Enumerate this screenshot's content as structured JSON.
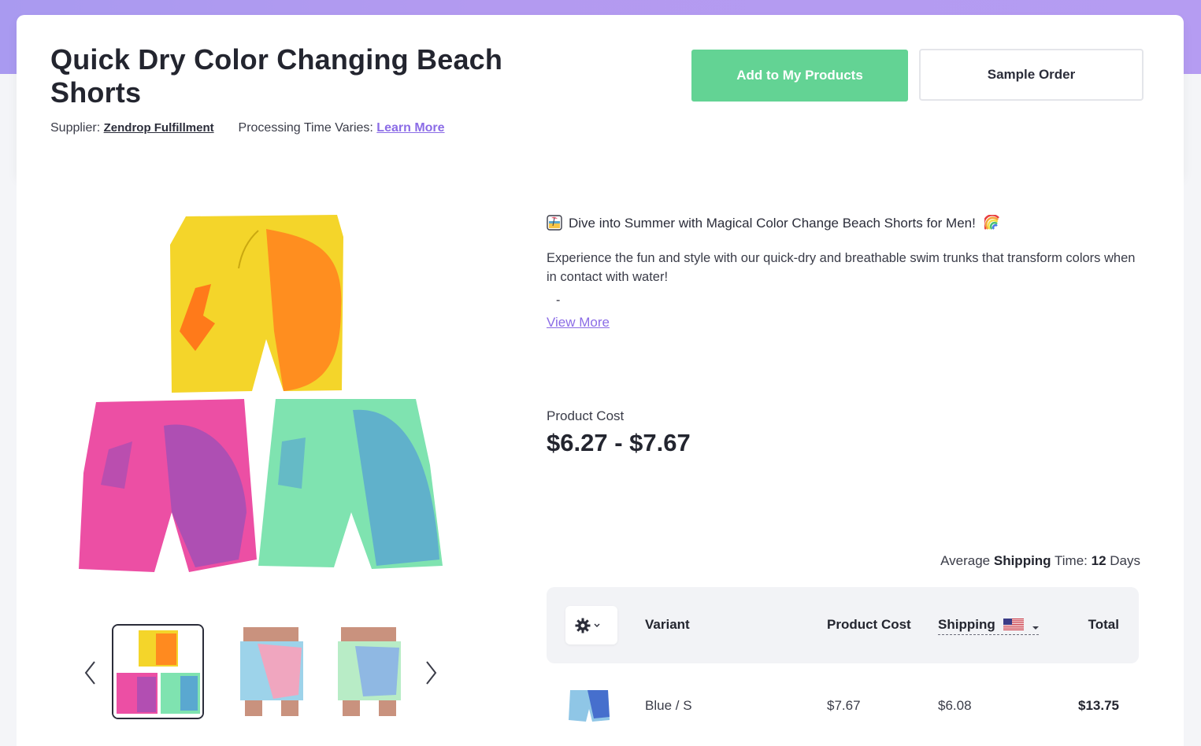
{
  "product": {
    "title": "Quick Dry Color Changing Beach Shorts",
    "supplier_label": "Supplier:",
    "supplier_name": "Zendrop Fulfillment",
    "processing_label": "Processing Time Varies:",
    "learn_more": "Learn More"
  },
  "actions": {
    "add_label": "Add to My Products",
    "sample_label": "Sample Order"
  },
  "description": {
    "headline": "Dive into Summer with Magical Color Change Beach Shorts for Men!",
    "body": "Experience the fun and style with our quick-dry and breathable swim trunks that transform colors when in contact with water!",
    "bullet": "-",
    "view_more": "View More"
  },
  "pricing": {
    "label": "Product Cost",
    "range": "$6.27 - $7.67"
  },
  "shipping_time": {
    "prefix": "Average",
    "bold_word": "Shipping",
    "middle": "Time:",
    "days": "12",
    "suffix": "Days"
  },
  "table": {
    "headers": {
      "variant": "Variant",
      "product_cost": "Product Cost",
      "shipping": "Shipping",
      "total": "Total"
    },
    "rows": [
      {
        "variant": "Blue / S",
        "product_cost": "$7.67",
        "shipping": "$6.08",
        "total": "$13.75"
      }
    ]
  },
  "icons": {
    "gear": "gear-icon",
    "flag": "us-flag-icon",
    "chevron": "chevron-down-icon",
    "prev": "chevron-left-icon",
    "next": "chevron-right-icon"
  },
  "colors": {
    "accent_green": "#63d394",
    "link_purple": "#8b6ce6",
    "header_gradient": "#b39af0"
  }
}
